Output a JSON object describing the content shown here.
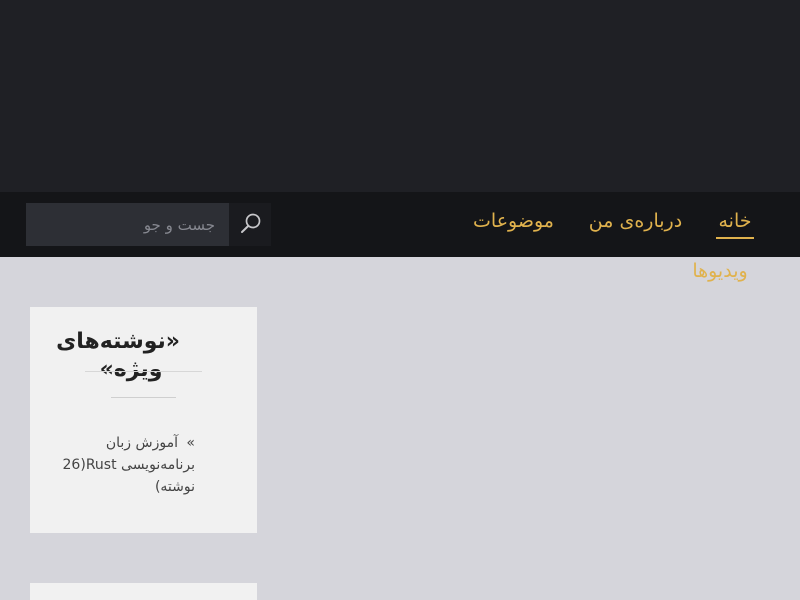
{
  "nav": {
    "items": [
      {
        "label": "خانه",
        "active": true
      },
      {
        "label": "درباره‌ی من",
        "active": false
      },
      {
        "label": "موضوعات",
        "active": false
      },
      {
        "label": "ویدیوها",
        "active": false
      }
    ]
  },
  "search": {
    "placeholder": "جست و جو",
    "icon": "search-icon"
  },
  "sidebar": {
    "featured_widget": {
      "title": "«نوشته‌های ویژه»",
      "items": [
        {
          "label": "آموزش زبان برنامه‌نویسی Rust",
          "count": "(26 نوشته)",
          "icon": "double-chevron-icon"
        }
      ]
    }
  },
  "colors": {
    "header_bg": "#1f2025",
    "nav_bg": "#141518",
    "nav_accent": "#e0b24d",
    "page_bg": "#d5d5db",
    "widget_bg": "#f1f1f1"
  }
}
